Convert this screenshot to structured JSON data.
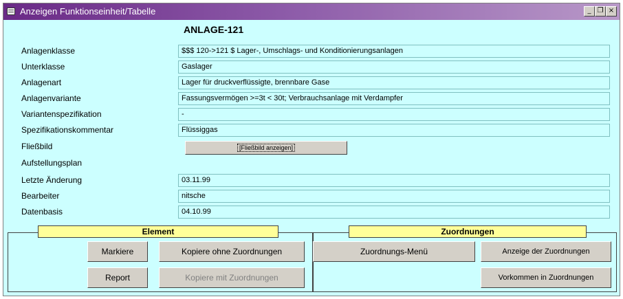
{
  "window": {
    "title": "Anzeigen Funktionseinheit/Tabelle",
    "minimize": "_",
    "restore": "❐",
    "close": "×"
  },
  "header": {
    "title": "ANLAGE-121"
  },
  "fields": {
    "anlagenklasse": {
      "label": "Anlagenklasse",
      "value": "$$$ 120->121 $ Lager-, Umschlags- und Konditionierungsanlagen"
    },
    "unterklasse": {
      "label": "Unterklasse",
      "value": "Gaslager"
    },
    "anlagenart": {
      "label": "Anlagenart",
      "value": "Lager für druckverflüssigte, brennbare Gase"
    },
    "anlagenvariante": {
      "label": "Anlagenvariante",
      "value": "Fassungsvermögen >=3t < 30t; Verbrauchsanlage mit Verdampfer"
    },
    "variantenspezifikation": {
      "label": "Variantenspezifikation",
      "value": "-"
    },
    "spezifikationskommentar": {
      "label": "Spezifikationskommentar",
      "value": "Flüssiggas"
    },
    "fliessbild": {
      "label": "Fließbild",
      "button": "[Fließbild anzeigen]"
    },
    "aufstellungsplan": {
      "label": "Aufstellungsplan"
    },
    "letzte_aenderung": {
      "label": "Letzte Änderung",
      "value": "03.11.99"
    },
    "bearbeiter": {
      "label": "Bearbeiter",
      "value": "nitsche"
    },
    "datenbasis": {
      "label": "Datenbasis",
      "value": "04.10.99"
    }
  },
  "element": {
    "label": "Element",
    "markiere": "Markiere",
    "kopiere_ohne": "Kopiere ohne Zuordnungen",
    "report": "Report",
    "kopiere_mit": "Kopiere mit Zuordnungen"
  },
  "zuordnungen": {
    "label": "Zuordnungen",
    "menu": "Zuordnungs-Menü",
    "anzeige": "Anzeige der Zuordnungen",
    "vorkommen": "Vorkommen in Zuordnungen"
  },
  "colors": {
    "background": "#ccffff",
    "title_bar": "#6a2a86",
    "group_label": "#ffff99"
  }
}
